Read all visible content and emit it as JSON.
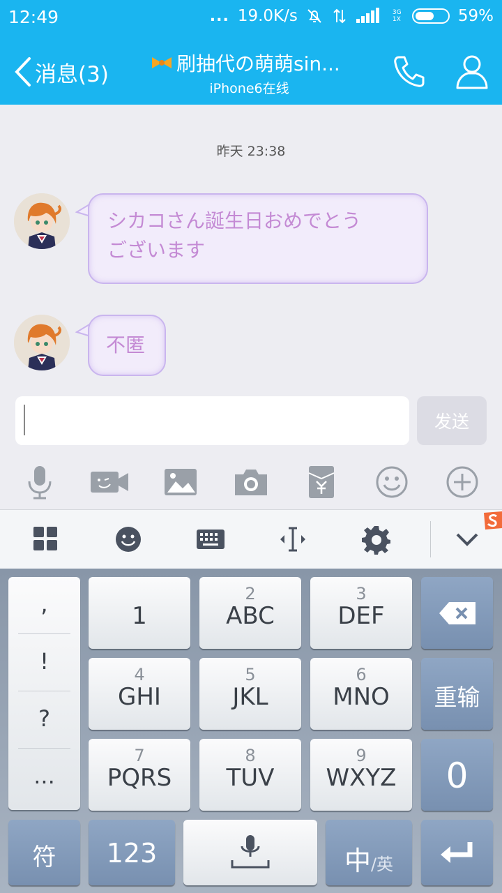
{
  "status_bar": {
    "time": "12:49",
    "dots": "...",
    "speed": "19.0K/s",
    "network": "3G 1X",
    "battery_percent": "59%",
    "battery_level": 0.59
  },
  "header": {
    "back_label": "消息(3)",
    "title": "刷抽代の萌萌sin...",
    "subtitle": "iPhone6在线"
  },
  "chat": {
    "timestamp": "昨天 23:38",
    "messages": [
      {
        "line1": "シカコさん誕生日おめでとう",
        "line2": "ございます"
      },
      {
        "line1": "不匿"
      }
    ]
  },
  "input": {
    "value": "",
    "send_label": "发送"
  },
  "keyboard": {
    "punct": [
      ",",
      "!",
      "?",
      "..."
    ],
    "keys": [
      {
        "num": "",
        "label": "1"
      },
      {
        "num": "2",
        "label": "ABC"
      },
      {
        "num": "3",
        "label": "DEF"
      },
      {
        "num": "4",
        "label": "GHI"
      },
      {
        "num": "5",
        "label": "JKL"
      },
      {
        "num": "6",
        "label": "MNO"
      },
      {
        "num": "7",
        "label": "PQRS"
      },
      {
        "num": "8",
        "label": "TUV"
      },
      {
        "num": "9",
        "label": "WXYZ"
      }
    ],
    "reenter": "重输",
    "zero": "0",
    "symbol": "符",
    "numeric": "123",
    "lang_main": "中",
    "lang_alt": "/英"
  },
  "colors": {
    "accent": "#1ab5f0",
    "bubble_text": "#c48ad4",
    "bubble_border": "#c9b5ee"
  }
}
